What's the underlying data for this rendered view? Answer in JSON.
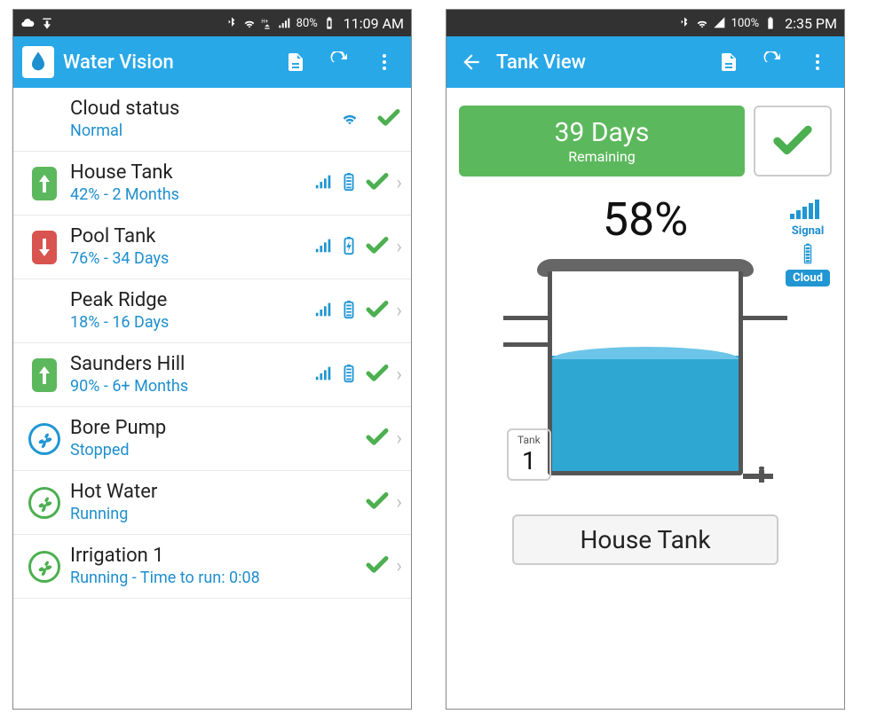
{
  "left": {
    "statusbar": {
      "battery": "80%",
      "time": "11:09 AM"
    },
    "appbar": {
      "title": "Water Vision"
    },
    "items": [
      {
        "icon": "wifi",
        "title": "Cloud status",
        "sub": "Normal",
        "showSignal": false,
        "showBattery": false,
        "showCheck": true,
        "chevron": false,
        "wifiRight": true
      },
      {
        "icon": "up-green",
        "title": "House Tank",
        "sub": "42% - 2 Months",
        "showSignal": true,
        "showBattery": true,
        "showCheck": true,
        "chevron": true
      },
      {
        "icon": "down-red",
        "title": "Pool Tank",
        "sub": "76% - 34 Days",
        "showSignal": true,
        "showBattery": true,
        "batteryCharge": true,
        "showCheck": true,
        "chevron": true
      },
      {
        "icon": "none",
        "title": "Peak Ridge",
        "sub": "18% - 16 Days",
        "showSignal": true,
        "showBattery": true,
        "showCheck": true,
        "chevron": true
      },
      {
        "icon": "up-green",
        "title": "Saunders Hill",
        "sub": "90% - 6+ Months",
        "showSignal": true,
        "showBattery": true,
        "showCheck": true,
        "chevron": true
      },
      {
        "icon": "fan-blue",
        "title": "Bore Pump",
        "sub": "Stopped",
        "showSignal": false,
        "showBattery": false,
        "showCheck": true,
        "chevron": true
      },
      {
        "icon": "fan-green",
        "title": "Hot Water",
        "sub": "Running",
        "showSignal": false,
        "showBattery": false,
        "showCheck": true,
        "chevron": true
      },
      {
        "icon": "fan-green",
        "title": "Irrigation 1",
        "sub": "Running - Time to run: 0:08",
        "showSignal": false,
        "showBattery": false,
        "showCheck": true,
        "chevron": true
      }
    ],
    "brand": {
      "word1": "Water",
      "word2": "Vision"
    }
  },
  "right": {
    "statusbar": {
      "battery": "100%",
      "time": "2:35 PM"
    },
    "appbar": {
      "title": "Tank View"
    },
    "days": {
      "value": "39 Days",
      "label": "Remaining"
    },
    "percent": "58%",
    "signalLabel": "Signal",
    "cloudLabel": "Cloud",
    "tankNumber": {
      "label": "Tank",
      "value": "1"
    },
    "tankName": "House Tank",
    "fillPercent": 58
  }
}
